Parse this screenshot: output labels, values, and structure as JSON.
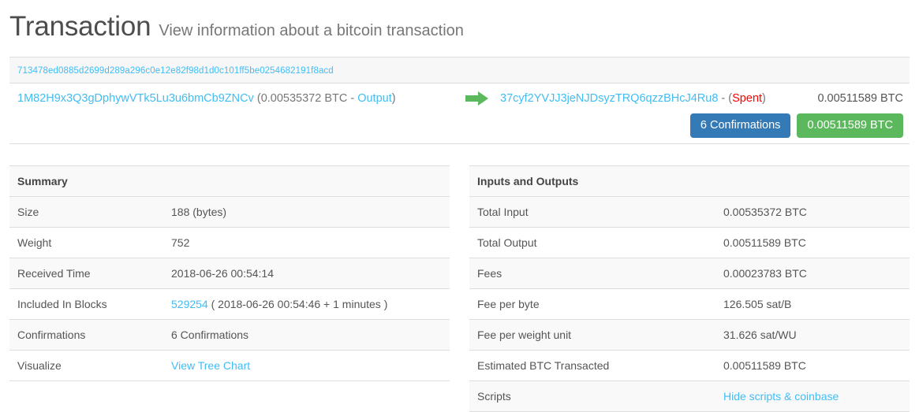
{
  "header": {
    "title": "Transaction",
    "subtitle": "View information about a bitcoin transaction"
  },
  "transaction": {
    "hash": "713478ed0885d2699d289a296c0e12e82f98d1d0c101ff5be0254682191f8acd",
    "input": {
      "address": "1M82H9x3Q3gDphywVTk5Lu3u6bmCb9ZNCv",
      "open_paren": "(",
      "amount": "0.00535372 BTC",
      "separator": " - ",
      "type_label": "Output",
      "close_paren": ")"
    },
    "arrow_icon": "arrow-right-icon",
    "output": {
      "address": "37cyf2YVJJ3jeNJDsyzTRQ6qzzBHcJ4Ru8",
      "separator": " - ",
      "open_paren": "(",
      "status": "Spent",
      "close_paren": ")",
      "amount": "0.00511589 BTC"
    },
    "badges": {
      "confirmations": "6 Confirmations",
      "amount": "0.00511589 BTC",
      "confirmations_color": "#337ab7",
      "amount_color": "#5cb85c"
    }
  },
  "summary_panel": {
    "title": "Summary",
    "rows": [
      {
        "key": "Size",
        "value": "188 (bytes)",
        "link": false
      },
      {
        "key": "Weight",
        "value": "752",
        "link": false
      },
      {
        "key": "Received Time",
        "value": "2018-06-26 00:54:14",
        "link": false
      },
      {
        "key": "Included In Blocks",
        "value": "529254",
        "link": true,
        "suffix": " ( 2018-06-26 00:54:46 + 1 minutes )"
      },
      {
        "key": "Confirmations",
        "value": "6 Confirmations",
        "link": false
      },
      {
        "key": "Visualize",
        "value": "View Tree Chart",
        "link": true
      }
    ]
  },
  "io_panel": {
    "title": "Inputs and Outputs",
    "rows": [
      {
        "key": "Total Input",
        "value": "0.00535372 BTC",
        "link": false
      },
      {
        "key": "Total Output",
        "value": "0.00511589 BTC",
        "link": false
      },
      {
        "key": "Fees",
        "value": "0.00023783 BTC",
        "link": false
      },
      {
        "key": "Fee per byte",
        "value": "126.505 sat/B",
        "link": false
      },
      {
        "key": "Fee per weight unit",
        "value": "31.626 sat/WU",
        "link": false
      },
      {
        "key": "Estimated BTC Transacted",
        "value": "0.00511589 BTC",
        "link": false
      },
      {
        "key": "Scripts",
        "value": "Hide scripts & coinbase",
        "link": true
      }
    ]
  },
  "colors": {
    "link": "#41bdf4",
    "spent": "#ff0000",
    "text": "#555555"
  }
}
